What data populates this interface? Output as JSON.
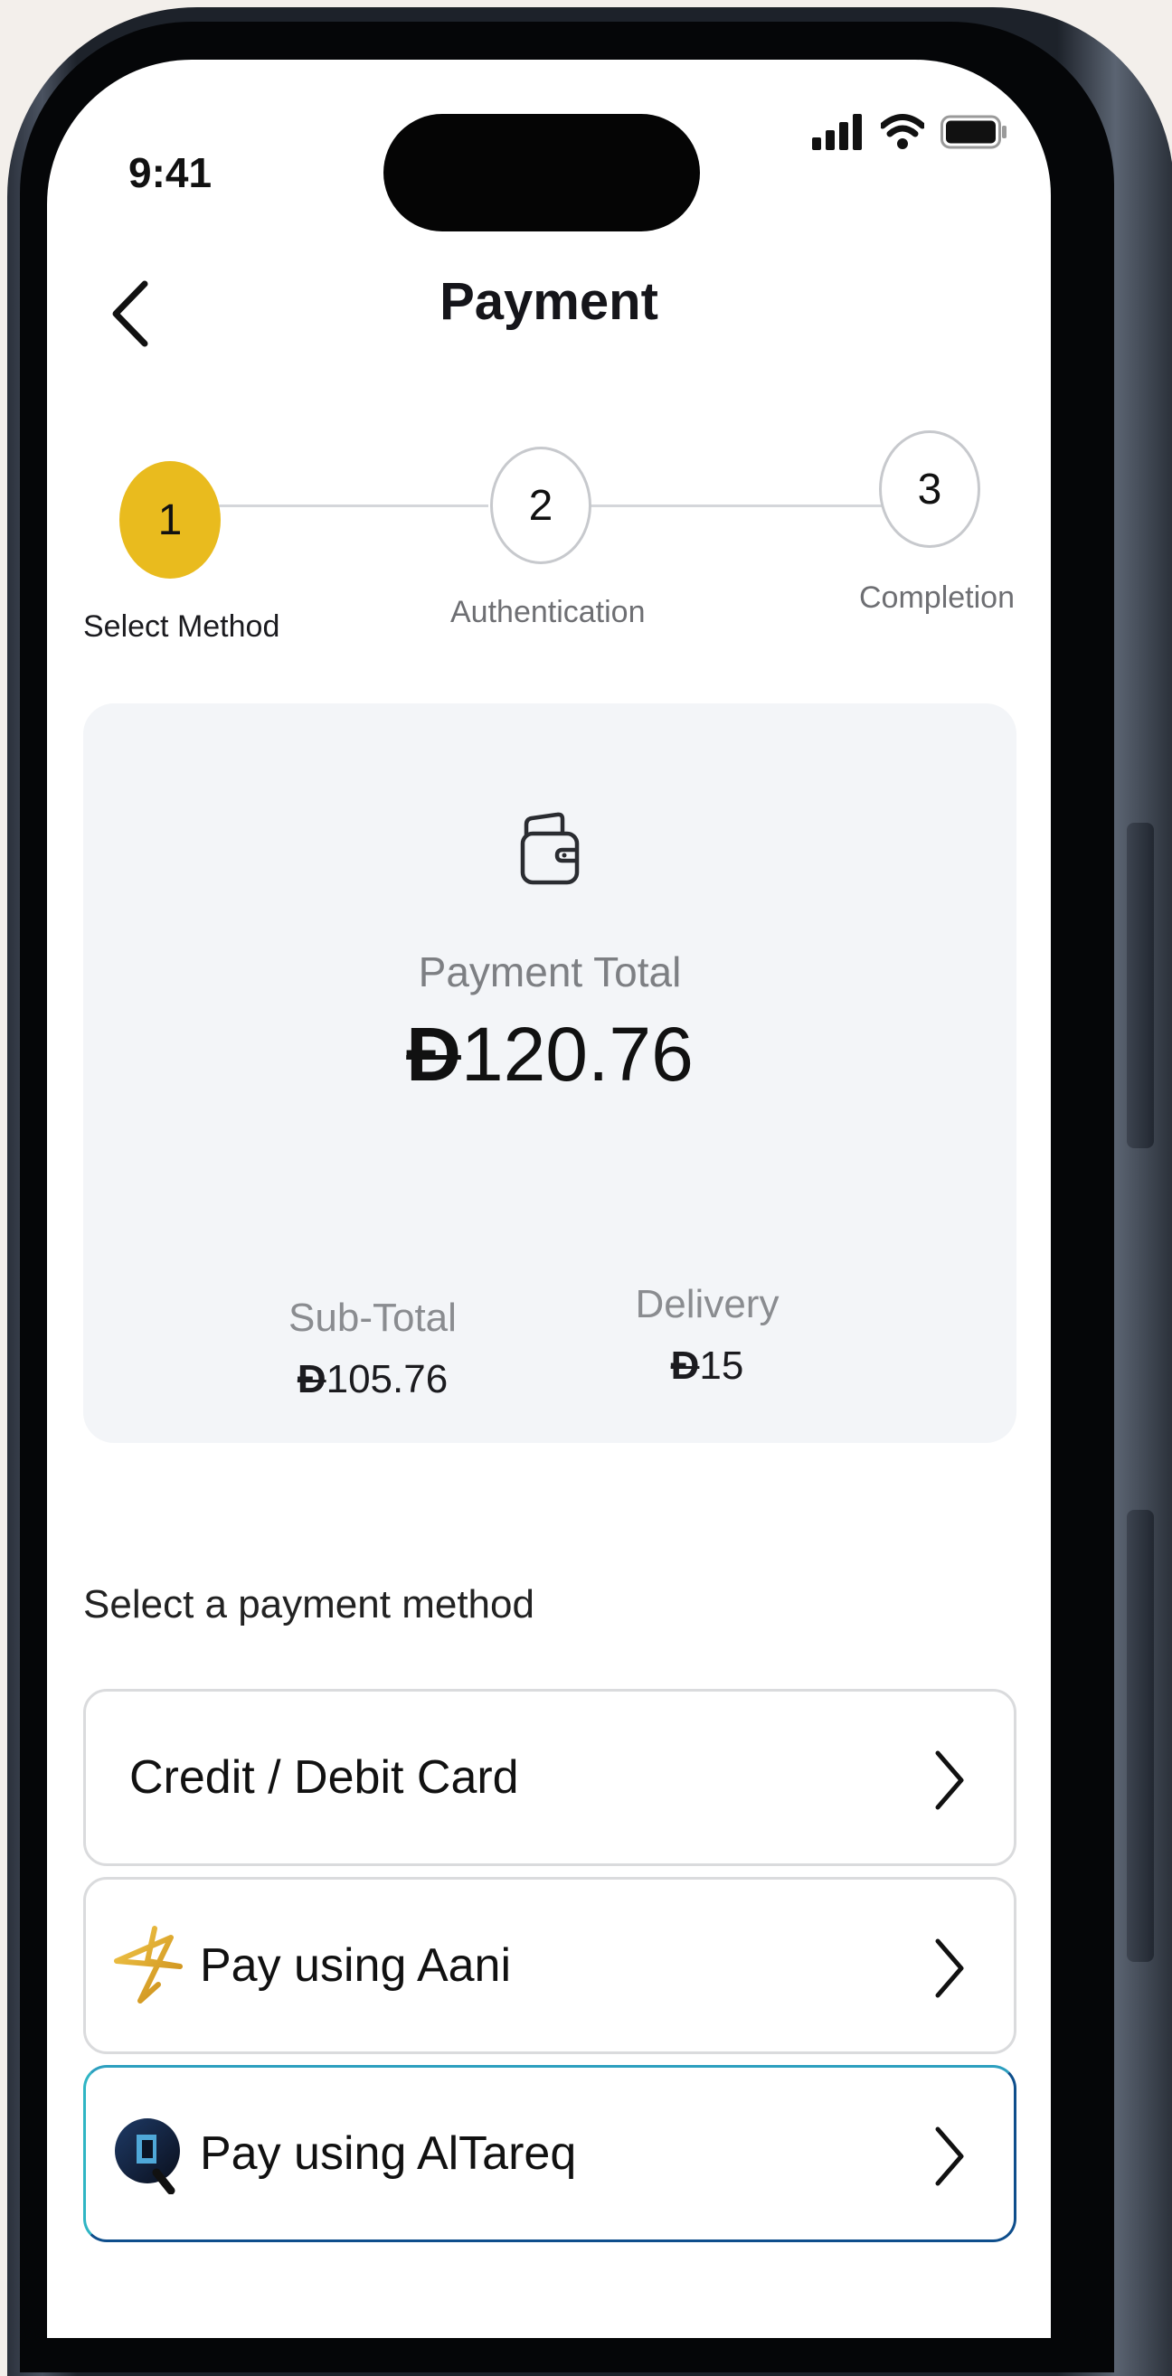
{
  "status_bar": {
    "time": "9:41"
  },
  "header": {
    "title": "Payment"
  },
  "stepper": {
    "steps": [
      {
        "number": "1",
        "label": "Select Method",
        "state": "active"
      },
      {
        "number": "2",
        "label": "Authentication",
        "state": "pending"
      },
      {
        "number": "3",
        "label": "Completion",
        "state": "pending"
      }
    ]
  },
  "summary": {
    "total_label": "Payment Total",
    "currency_symbol": "Đ",
    "total_value": "120.76",
    "subtotal_label": "Sub-Total",
    "subtotal_value": "105.76",
    "delivery_label": "Delivery",
    "delivery_value": "15"
  },
  "payment_methods": {
    "heading": "Select a payment method",
    "items": [
      {
        "label": "Credit / Debit Card",
        "icon": "none"
      },
      {
        "label": "Pay using Aani",
        "icon": "aani-star-icon"
      },
      {
        "label": "Pay using AlTareq",
        "icon": "altareq-logo-icon",
        "selected": true
      }
    ]
  },
  "colors": {
    "accent": "#e9bb1e",
    "card_background": "#f3f5f8",
    "selected_border": "#2a8fb0"
  }
}
